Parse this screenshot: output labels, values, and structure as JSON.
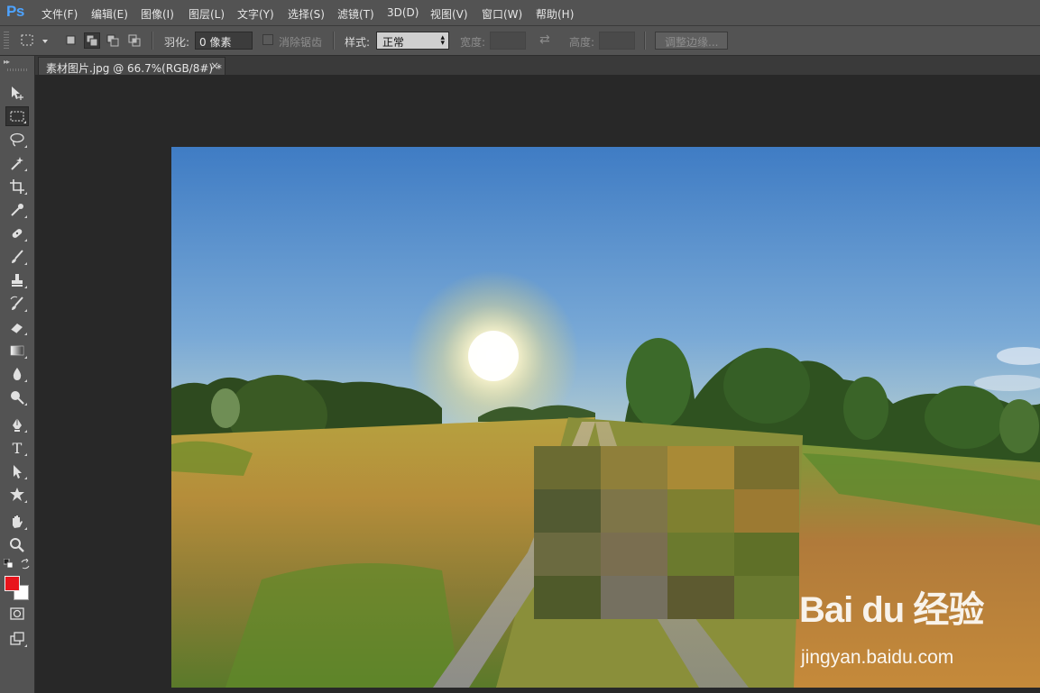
{
  "app": {
    "logo": "Ps"
  },
  "menu": [
    "文件(F)",
    "编辑(E)",
    "图像(I)",
    "图层(L)",
    "文字(Y)",
    "选择(S)",
    "滤镜(T)",
    "3D(D)",
    "视图(V)",
    "窗口(W)",
    "帮助(H)"
  ],
  "options": {
    "feather_label": "羽化:",
    "feather_value": "0 像素",
    "antialias_label": "消除锯齿",
    "style_label": "样式:",
    "style_value": "正常",
    "width_label": "宽度:",
    "height_label": "高度:",
    "refine_edge_label": "调整边缘..."
  },
  "document": {
    "tab_title": "素材图片.jpg @ 66.7%(RGB/8#) *",
    "close_glyph": "×"
  },
  "tools": [
    {
      "name": "move-tool-icon"
    },
    {
      "name": "rectangular-marquee-icon",
      "active": true
    },
    {
      "name": "lasso-icon"
    },
    {
      "name": "magic-wand-icon"
    },
    {
      "name": "crop-icon"
    },
    {
      "name": "eyedropper-icon"
    },
    {
      "name": "healing-brush-icon"
    },
    {
      "name": "brush-icon"
    },
    {
      "name": "clone-stamp-icon"
    },
    {
      "name": "history-brush-icon"
    },
    {
      "name": "eraser-icon"
    },
    {
      "name": "gradient-icon"
    },
    {
      "name": "blur-icon"
    },
    {
      "name": "dodge-icon"
    },
    {
      "name": "pen-icon"
    },
    {
      "name": "type-icon"
    },
    {
      "name": "path-selection-icon"
    },
    {
      "name": "custom-shape-icon"
    },
    {
      "name": "hand-icon"
    },
    {
      "name": "zoom-icon"
    }
  ],
  "colors": {
    "foreground": "#e8141c",
    "background": "#ffffff",
    "accent": "#4da3ff"
  },
  "type_tool_glyph": "T",
  "watermark": {
    "logo": "Bai du 经验",
    "url": "jingyan.baidu.com"
  }
}
